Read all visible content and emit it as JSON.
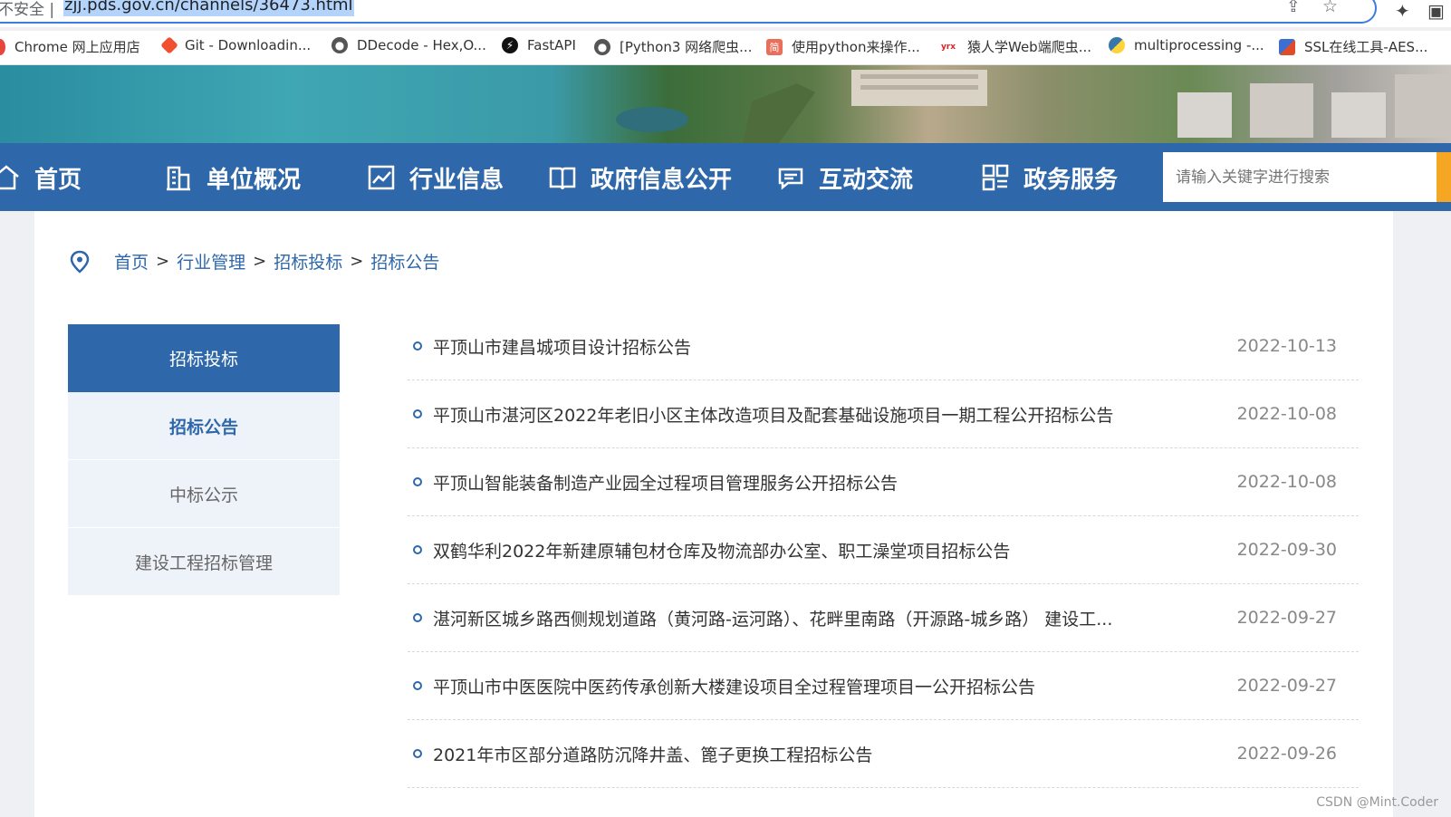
{
  "browser": {
    "secure_label": "不安全 |",
    "url": "zjj.pds.gov.cn/channels/36473.html",
    "icons": [
      "share-icon",
      "star-icon",
      "extensions-icon",
      "side-panel-icon"
    ]
  },
  "bookmarks": [
    {
      "label": "Chrome 网上应用店",
      "icon": "chrome-store-icon",
      "color": "#e8453c"
    },
    {
      "label": "Git - Downloadin...",
      "icon": "git-icon",
      "color": "#f1502f"
    },
    {
      "label": "DDecode - Hex,O...",
      "icon": "globe-icon",
      "color": "#555555"
    },
    {
      "label": "FastAPI",
      "icon": "fastapi-icon",
      "color": "#111111"
    },
    {
      "label": "[Python3 网络爬虫...",
      "icon": "globe-icon",
      "color": "#555555"
    },
    {
      "label": "使用python来操作...",
      "icon": "jianshu-icon",
      "color": "#ea6f5a"
    },
    {
      "label": "猿人学Web端爬虫...",
      "icon": "yrx-icon",
      "color": "#e02020"
    },
    {
      "label": "multiprocessing -...",
      "icon": "python-icon",
      "color": "#3776ab"
    },
    {
      "label": "SSL在线工具-AES...",
      "icon": "ssl-icon",
      "color": "#e04b2a"
    }
  ],
  "nav": {
    "items": [
      {
        "label": "首页",
        "icon": "home-icon"
      },
      {
        "label": "单位概况",
        "icon": "building-icon"
      },
      {
        "label": "行业信息",
        "icon": "chart-icon"
      },
      {
        "label": "政府信息公开",
        "icon": "book-icon"
      },
      {
        "label": "互动交流",
        "icon": "chat-icon"
      },
      {
        "label": "政务服务",
        "icon": "grid-icon"
      }
    ],
    "search_placeholder": "请输入关键字进行搜索"
  },
  "breadcrumb": {
    "icon": "location-pin-icon",
    "items": [
      "首页",
      "行业管理",
      "招标投标",
      "招标公告"
    ]
  },
  "sidebar": {
    "header": "招标投标",
    "items": [
      {
        "label": "招标公告",
        "active": true
      },
      {
        "label": "中标公示",
        "active": false
      },
      {
        "label": "建设工程招标管理",
        "active": false
      }
    ]
  },
  "list": {
    "rows": [
      {
        "title": "平顶山市建昌城项目设计招标公告",
        "date": "2022-10-13"
      },
      {
        "title": "平顶山市湛河区2022年老旧小区主体改造项目及配套基础设施项目一期工程公开招标公告",
        "date": "2022-10-08"
      },
      {
        "title": "平顶山智能装备制造产业园全过程项目管理服务公开招标公告",
        "date": "2022-10-08"
      },
      {
        "title": "双鹤华利2022年新建原辅包材仓库及物流部办公室、职工澡堂项目招标公告",
        "date": "2022-09-30"
      },
      {
        "title": "湛河新区城乡路西侧规划道路（黄河路-运河路）、花畔里南路（开源路-城乡路） 建设工...",
        "date": "2022-09-27"
      },
      {
        "title": "平顶山市中医医院中医药传承创新大楼建设项目全过程管理项目一公开招标公告",
        "date": "2022-09-27"
      },
      {
        "title": "2021年市区部分道路防沉降井盖、篦子更换工程招标公告",
        "date": "2022-09-26"
      }
    ]
  },
  "watermark": "CSDN @Mint.Coder",
  "colors": {
    "primary": "#2e67aa",
    "accent": "#f5a623",
    "sidebar_bg": "#eef3fa"
  }
}
